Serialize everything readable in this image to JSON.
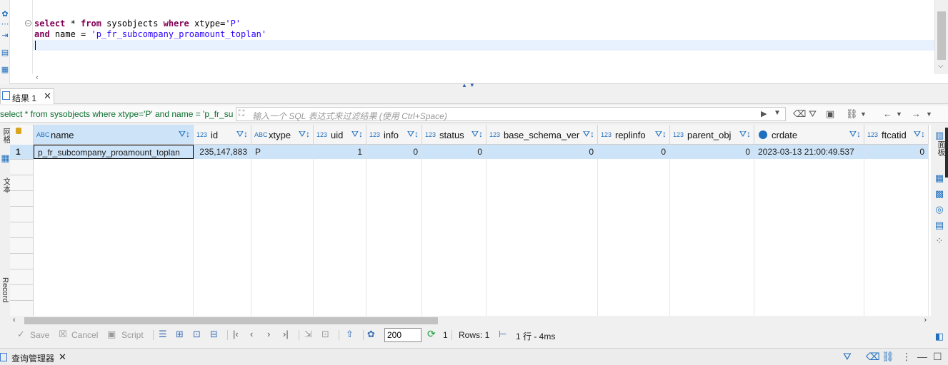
{
  "editor": {
    "line1": {
      "kw1": "select",
      "p1": " * ",
      "kw2": "from",
      "p2": " sysobjects ",
      "kw3": "where",
      "p3": " xtype=",
      "s1": "'P'"
    },
    "line2": {
      "kw1": "and",
      "p1": " name = ",
      "s1": "'p_fr_subcompany_proamount_toplan'"
    }
  },
  "results_tab": {
    "label": "结果 1"
  },
  "filter": {
    "sql_text": "select * from sysobjects where xtype='P' and name = 'p_fr_subcompany_proamount_toplan'",
    "placeholder": "输入一个 SQL 表达式来过滤结果 (使用 Ctrl+Space)"
  },
  "grid": {
    "columns": [
      {
        "type": "ABC",
        "name": "name"
      },
      {
        "type": "123",
        "name": "id"
      },
      {
        "type": "ABC",
        "name": "xtype"
      },
      {
        "type": "123",
        "name": "uid"
      },
      {
        "type": "123",
        "name": "info"
      },
      {
        "type": "123",
        "name": "status"
      },
      {
        "type": "123",
        "name": "base_schema_ver"
      },
      {
        "type": "123",
        "name": "replinfo"
      },
      {
        "type": "123",
        "name": "parent_obj"
      },
      {
        "type": "clock",
        "name": "crdate"
      },
      {
        "type": "123",
        "name": "ftcatid"
      }
    ],
    "rows": [
      {
        "num": "1",
        "cells": [
          "p_fr_subcompany_proamount_toplan",
          "235,147,883",
          "P",
          "1",
          "0",
          "0",
          "0",
          "0",
          "0",
          "2023-03-13 21:00:49.537",
          "0"
        ]
      }
    ]
  },
  "left_panel": {
    "grid_label": "网格",
    "text_label": "文本",
    "record_label": "Record"
  },
  "right_panel": {
    "label": "面板"
  },
  "bottom_toolbar": {
    "save": "Save",
    "cancel": "Cancel",
    "script": "Script",
    "fetch_size": "200",
    "refresh_count": "1",
    "rows_label": "Rows: 1",
    "row_info": "1 行 - 4ms"
  },
  "status_bar": {
    "label": "查询管理器"
  }
}
